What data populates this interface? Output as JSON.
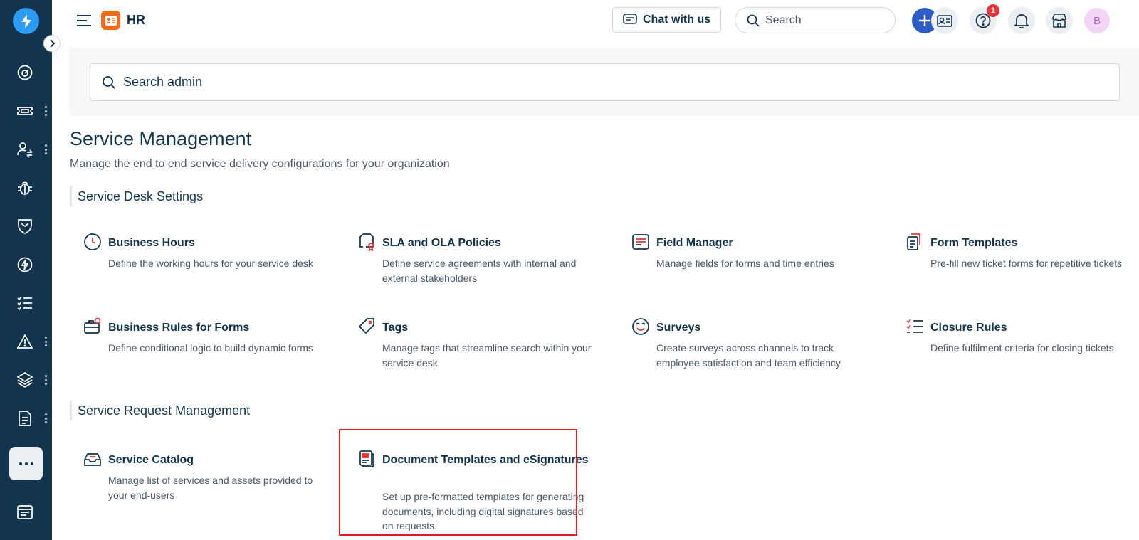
{
  "topbar": {
    "workspace_title": "HR",
    "chat_label": "Chat with us",
    "search_placeholder": "Search",
    "notification_count": "1",
    "avatar_initial": "B"
  },
  "admin_search": {
    "placeholder": "Search admin"
  },
  "page": {
    "title": "Service Management",
    "description": "Manage the end to end service delivery configurations for your organization"
  },
  "sections": {
    "service_desk": {
      "heading": "Service Desk Settings",
      "cards": [
        {
          "title": "Business Hours",
          "desc": "Define the working hours for your service desk"
        },
        {
          "title": "SLA and OLA Policies",
          "desc": "Define service agreements with internal and external stakeholders"
        },
        {
          "title": "Field Manager",
          "desc": "Manage fields for forms and time entries"
        },
        {
          "title": "Form Templates",
          "desc": "Pre-fill new ticket forms for repetitive tickets"
        },
        {
          "title": "Business Rules for Forms",
          "desc": "Define conditional logic to build dynamic forms"
        },
        {
          "title": "Tags",
          "desc": "Manage tags that streamline search within your service desk"
        },
        {
          "title": "Surveys",
          "desc": "Create surveys across channels to track employee satisfaction and team efficiency"
        },
        {
          "title": "Closure Rules",
          "desc": "Define fulfilment criteria for closing tickets"
        }
      ]
    },
    "service_request": {
      "heading": "Service Request Management",
      "cards": [
        {
          "title": "Service Catalog",
          "desc": "Manage list of services and assets provided to your end-users"
        },
        {
          "title": "Document Templates and eSignatures",
          "desc": "Set up pre-formatted templates for generating documents, including digital signatures based on requests"
        }
      ]
    }
  },
  "colors": {
    "sidebar_bg": "#12344d",
    "primary": "#2c5cc5",
    "accent_red": "#e43538",
    "highlight_border": "#e02020",
    "workspace_orange": "#f26a1b"
  }
}
